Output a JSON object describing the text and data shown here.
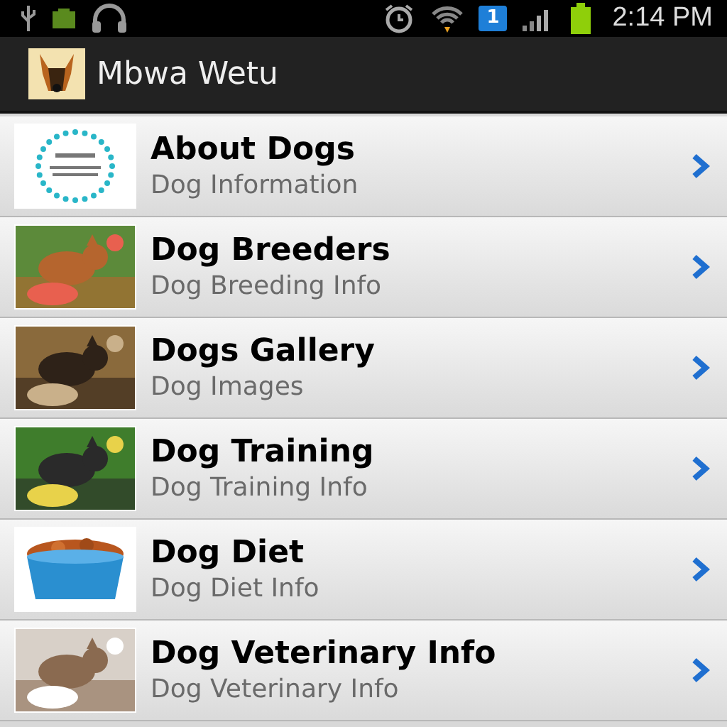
{
  "status_bar": {
    "notification_badge": "1",
    "time": "2:14 PM"
  },
  "action_bar": {
    "title": "Mbwa Wetu"
  },
  "items": [
    {
      "title": "About Dogs",
      "subtitle": "Dog Information"
    },
    {
      "title": "Dog Breeders",
      "subtitle": "Dog Breeding Info"
    },
    {
      "title": "Dogs Gallery",
      "subtitle": "Dog Images"
    },
    {
      "title": "Dog Training",
      "subtitle": "Dog Training Info"
    },
    {
      "title": "Dog Diet",
      "subtitle": "Dog Diet Info"
    },
    {
      "title": "Dog Veterinary Info",
      "subtitle": "Dog Veterinary Info"
    }
  ]
}
